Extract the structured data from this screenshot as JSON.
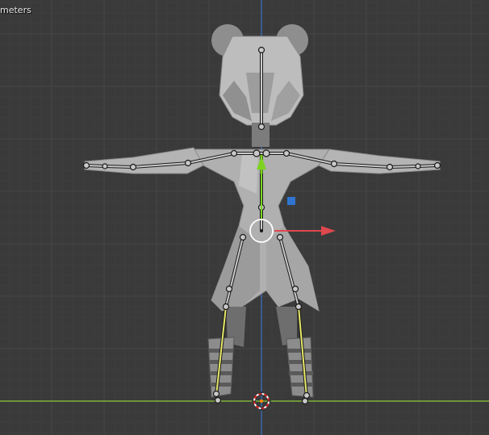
{
  "viewport": {
    "unit_label": "meters"
  },
  "colors": {
    "background": "#3a3a3a",
    "grid_minor": "#404040",
    "grid_major": "#454545",
    "axis_x": "#7fb23a",
    "axis_z": "#3c6bb4",
    "mesh_light": "#b9b9b9",
    "mesh_mid": "#9e9e9e",
    "mesh_dark": "#707070",
    "bone_outline": "#1a1a1a",
    "bone_fill": "#c9c9c9",
    "bone_selected": "#e8e86a",
    "gizmo_x": "#e0484f",
    "gizmo_y": "#7ed321",
    "gizmo_z": "#2f74d0",
    "cursor_red": "#e02020"
  },
  "icons": {
    "cursor": "3d-cursor-icon",
    "gizmo": "transform-gizmo-icon"
  }
}
